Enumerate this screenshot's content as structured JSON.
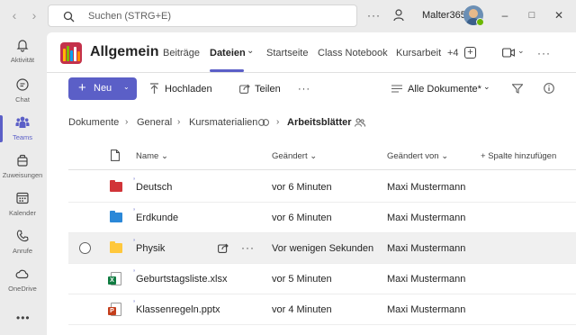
{
  "titlebar": {
    "search_placeholder": "Suchen (STRG+E)",
    "more_label": "···",
    "username": "Malter365",
    "presence": "available"
  },
  "rail": [
    {
      "label": "Aktivität",
      "icon": "bell-icon"
    },
    {
      "label": "Chat",
      "icon": "chat-icon"
    },
    {
      "label": "Teams",
      "icon": "teams-icon",
      "active": true
    },
    {
      "label": "Zuweisungen",
      "icon": "assignments-icon"
    },
    {
      "label": "Kalender",
      "icon": "calendar-icon"
    },
    {
      "label": "Anrufe",
      "icon": "phone-icon"
    },
    {
      "label": "OneDrive",
      "icon": "cloud-icon"
    }
  ],
  "rail_more": "•••",
  "channel": {
    "title": "Allgemein",
    "tabs": [
      "Beiträge",
      "Dateien",
      "Startseite",
      "Class Notebook",
      "Kursarbeit",
      "+4"
    ],
    "active_tab": "Dateien",
    "active_tab_chevron": "⌄"
  },
  "commands": {
    "new": "Neu",
    "upload": "Hochladen",
    "share": "Teilen",
    "more": "···",
    "view": "Alle Dokumente*"
  },
  "breadcrumb": [
    "Dokumente",
    "General",
    "Kursmaterialien",
    "Arbeitsblätter"
  ],
  "columns": {
    "name": "Name",
    "modified": "Geändert",
    "modified_by": "Geändert von",
    "add_column": "Spalte hinzufügen"
  },
  "files": [
    {
      "name": "Deutsch",
      "type": "folder",
      "color": "#d13438",
      "modified": "vor 6 Minuten",
      "by": "Maxi Mustermann"
    },
    {
      "name": "Erdkunde",
      "type": "folder",
      "color": "#2b88d8",
      "modified": "vor 6 Minuten",
      "by": "Maxi Mustermann"
    },
    {
      "name": "Physik",
      "type": "folder",
      "color": "#ffc83d",
      "modified": "Vor wenigen Sekunden",
      "by": "Maxi Mustermann"
    },
    {
      "name": "Geburtstagsliste.xlsx",
      "type": "xlsx",
      "color": "#107c41",
      "modified": "vor 5 Minuten",
      "by": "Maxi Mustermann"
    },
    {
      "name": "Klassenregeln.pptx",
      "type": "pptx",
      "color": "#c43e1c",
      "modified": "vor 4 Minuten",
      "by": "Maxi Mustermann"
    }
  ],
  "colors": {
    "accent": "#5b5fc7",
    "presence": "#6bb700"
  }
}
